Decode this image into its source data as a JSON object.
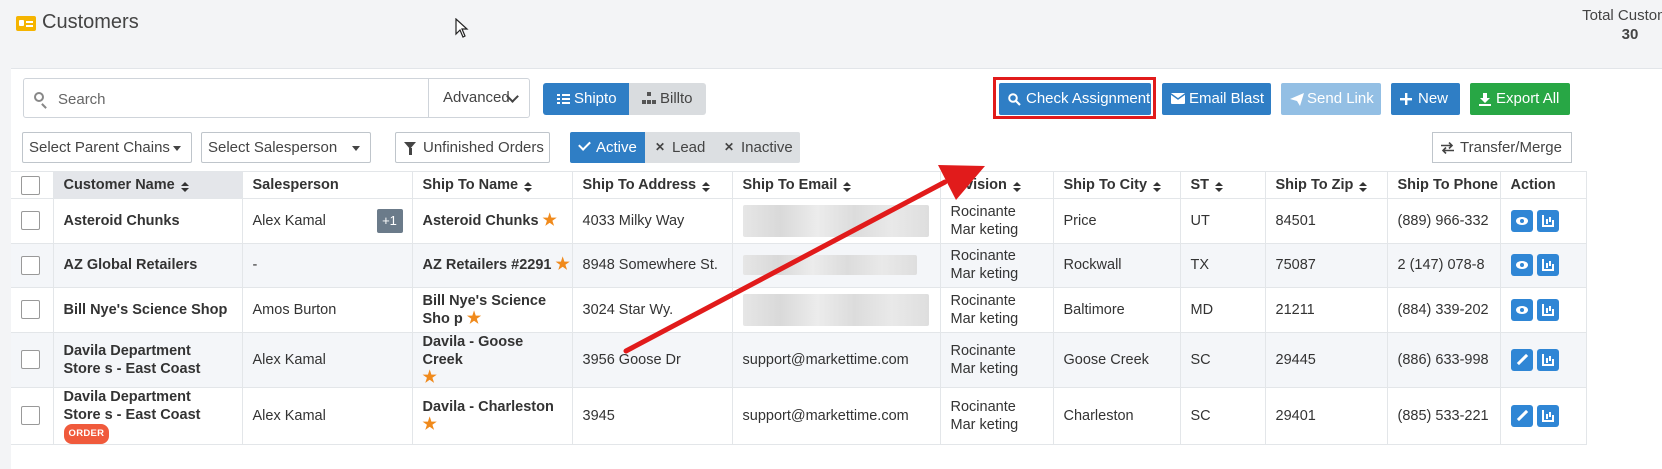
{
  "header": {
    "title": "Customers",
    "total_label": "Total Custome",
    "total_value": "30"
  },
  "toolbar": {
    "search_placeholder": "Search",
    "advanced_label": "Advanced",
    "shipto_label": "Shipto",
    "billto_label": "Billto",
    "check_assignment_label": "Check Assignment",
    "email_blast_label": "Email Blast",
    "send_link_label": "Send Link",
    "new_label": "New",
    "export_all_label": "Export All"
  },
  "filters": {
    "parent_chains": "Select Parent Chains",
    "salesperson": "Select Salesperson",
    "unfinished_orders": "Unfinished Orders",
    "active": "Active",
    "lead": "Lead",
    "inactive": "Inactive",
    "transfer_merge": "Transfer/Merge"
  },
  "table": {
    "columns": [
      "Customer Name",
      "Salesperson",
      "Ship To Name",
      "Ship To Address",
      "Ship To Email",
      "Division",
      "Ship To City",
      "ST",
      "Ship To Zip",
      "Ship To Phone",
      "Action"
    ],
    "rows": [
      {
        "customer_name": "Asteroid Chunks",
        "salesperson": "Alex Kamal",
        "extra_sales": "+1",
        "ship_to_name": "Asteroid Chunks",
        "address": "4033 Milky Way",
        "email": "",
        "division": "Rocinante Mar keting",
        "city": "Price",
        "st": "UT",
        "zip": "84501",
        "phone": "(889) 966-332"
      },
      {
        "customer_name": "AZ Global Retailers",
        "salesperson": "-",
        "ship_to_name": "AZ Retailers #2291",
        "address": "8948 Somewhere St.",
        "email": "",
        "division": "Rocinante Mar keting",
        "city": "Rockwall",
        "st": "TX",
        "zip": "75087",
        "phone": "2 (147) 078-8"
      },
      {
        "customer_name": "Bill Nye's Science Shop",
        "salesperson": "Amos Burton",
        "ship_to_name": "Bill Nye's Science Sho p",
        "address": "3024 Star Wy.",
        "email": "",
        "division": "Rocinante Mar keting",
        "city": "Baltimore",
        "st": "MD",
        "zip": "21211",
        "phone": "(884) 339-202"
      },
      {
        "customer_name": "Davila Department Store s - East Coast",
        "salesperson": "Alex Kamal",
        "ship_to_name": "Davila - Goose Creek",
        "address": "3956 Goose Dr",
        "email": "support@markettime.com",
        "division": "Rocinante Mar keting",
        "city": "Goose Creek",
        "st": "SC",
        "zip": "29445",
        "phone": "(886) 633-998"
      },
      {
        "customer_name": "Davila Department Store s - East Coast",
        "badge": "ORDER",
        "salesperson": "Alex Kamal",
        "ship_to_name": "Davila - Charleston",
        "address": "3945",
        "email": "support@markettime.com",
        "division": "Rocinante Mar keting",
        "city": "Charleston",
        "st": "SC",
        "zip": "29401",
        "phone": "(885) 533-221"
      }
    ]
  },
  "colors": {
    "primary": "#2f7ec5",
    "success": "#28a745",
    "highlight": "#e11b1b",
    "star": "#f08a1c",
    "badge": "#f05a3c"
  }
}
